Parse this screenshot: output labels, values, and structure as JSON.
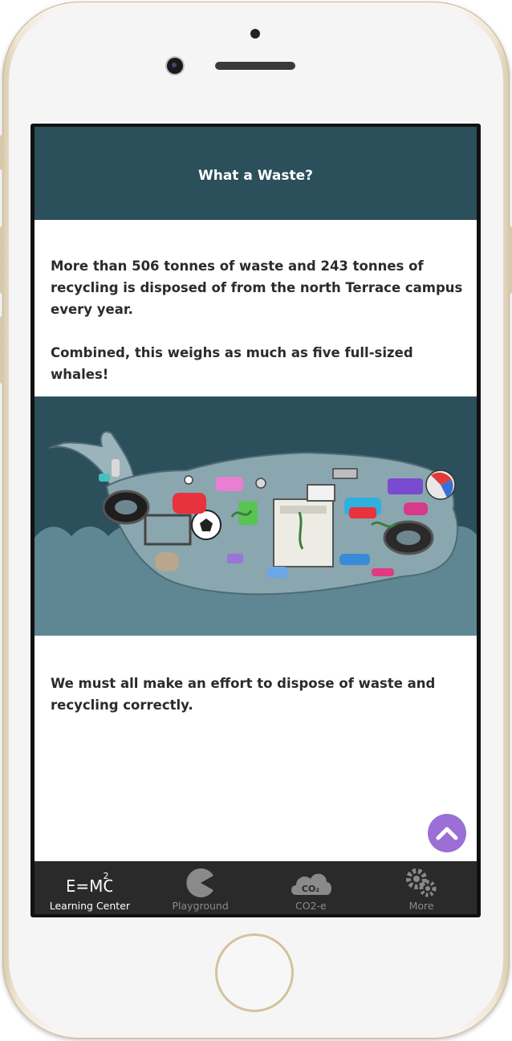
{
  "header": {
    "title": "What a Waste?"
  },
  "content": {
    "paragraph_1": "More than 506 tonnes of waste and 243 tonnes of recycling is disposed of from the north Terrace campus every year.",
    "paragraph_2": "Combined, this weighs as much as five full-sized whales!",
    "paragraph_3": "We must all make an effort to dispose of waste and recycling correctly.",
    "illustration": {
      "icon": "whale-of-waste-illustration",
      "sea_color": "#5e8793",
      "sky_color": "#2b4f5b"
    }
  },
  "scroll_top_button": {
    "icon": "chevron-up-icon",
    "color": "#9b6fd6"
  },
  "tabbar": {
    "tabs": [
      {
        "label": "Learning Center",
        "icon": "emc2-icon",
        "active": true
      },
      {
        "label": "Playground",
        "icon": "pacman-icon",
        "active": false
      },
      {
        "label": "CO2-e",
        "icon": "co2-cloud-icon",
        "icon_text": "CO₂",
        "active": false
      },
      {
        "label": "More",
        "icon": "gears-icon",
        "active": false
      }
    ]
  },
  "theme": {
    "header_color": "#2b4f5b",
    "tabbar_color": "#2a2a2a",
    "accent": "#9b6fd6"
  }
}
